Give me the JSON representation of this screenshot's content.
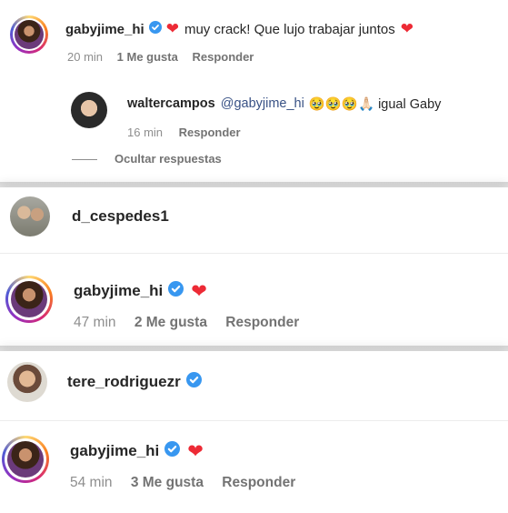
{
  "comments": [
    {
      "username": "gabyjime_hi",
      "text": "muy crack! Que lujo trabajar juntos",
      "time": "20 min",
      "likes": "1 Me gusta",
      "reply": "Responder"
    },
    {
      "username": "waltercampos",
      "mention": "@gabyjime_hi",
      "text": "🥹🥹🥹🙏🏻 igual Gaby",
      "time": "16 min",
      "reply": "Responder"
    },
    {
      "username": "d_cespedes1"
    },
    {
      "username": "gabyjime_hi",
      "time": "47 min",
      "likes": "2 Me gusta",
      "reply": "Responder"
    },
    {
      "username": "tere_rodriguezr"
    },
    {
      "username": "gabyjime_hi",
      "time": "54 min",
      "likes": "3 Me gusta",
      "reply": "Responder"
    }
  ],
  "hide_replies": "Ocultar respuestas",
  "colors": {
    "verified": "#3897f0",
    "heart": "#ed2a35",
    "meta": "#8e8e8e"
  },
  "icons": {
    "verified": "verified-badge-icon",
    "heart": "red-heart-icon"
  }
}
